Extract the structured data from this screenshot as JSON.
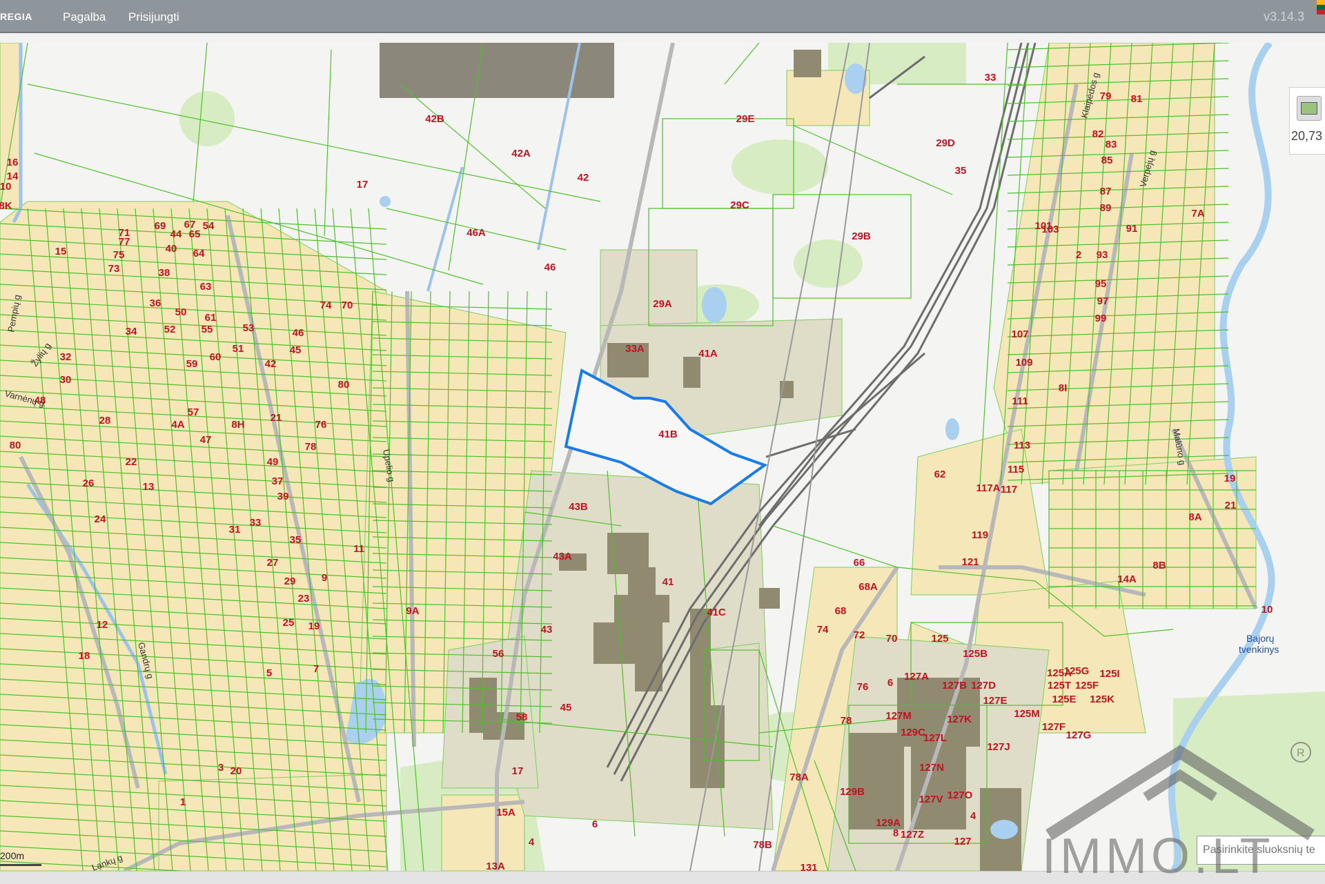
{
  "header": {
    "brand": "REGIA",
    "menu": [
      "Pagalba",
      "Prisijungti"
    ],
    "version": "v3.14.3"
  },
  "map": {
    "parcel_labels": [
      {
        "t": "42B"
      },
      {
        "t": "42A"
      },
      {
        "t": "42"
      },
      {
        "t": "46A"
      },
      {
        "t": "46"
      },
      {
        "t": "17"
      },
      {
        "t": "29E"
      },
      {
        "t": "29D"
      },
      {
        "t": "35"
      },
      {
        "t": "33"
      },
      {
        "t": "29C"
      },
      {
        "t": "29B"
      },
      {
        "t": "29A"
      },
      {
        "t": "33A"
      },
      {
        "t": "41A"
      },
      {
        "t": "41B"
      },
      {
        "t": "43B"
      },
      {
        "t": "43A"
      },
      {
        "t": "41"
      },
      {
        "t": "41C"
      },
      {
        "t": "43"
      },
      {
        "t": "45"
      },
      {
        "t": "56"
      },
      {
        "t": "58"
      },
      {
        "t": "17"
      },
      {
        "t": "15A"
      },
      {
        "t": "6"
      },
      {
        "t": "4"
      },
      {
        "t": "13A"
      },
      {
        "t": "78B"
      },
      {
        "t": "78A"
      },
      {
        "t": "131"
      },
      {
        "t": "66"
      },
      {
        "t": "68A"
      },
      {
        "t": "68"
      },
      {
        "t": "74"
      },
      {
        "t": "72"
      },
      {
        "t": "70"
      },
      {
        "t": "76"
      },
      {
        "t": "78"
      },
      {
        "t": "125"
      },
      {
        "t": "125B"
      },
      {
        "t": "125A"
      },
      {
        "t": "127A"
      },
      {
        "t": "127B"
      },
      {
        "t": "127D"
      },
      {
        "t": "127E"
      },
      {
        "t": "125M"
      },
      {
        "t": "127M"
      },
      {
        "t": "127K"
      },
      {
        "t": "127F"
      },
      {
        "t": "129C"
      },
      {
        "t": "127L"
      },
      {
        "t": "127G"
      },
      {
        "t": "127J"
      },
      {
        "t": "127N"
      },
      {
        "t": "129B"
      },
      {
        "t": "127V"
      },
      {
        "t": "127O"
      },
      {
        "t": "129A"
      },
      {
        "t": "127Z"
      },
      {
        "t": "127"
      },
      {
        "t": "125G"
      },
      {
        "t": "125T"
      },
      {
        "t": "125F"
      },
      {
        "t": "125I"
      },
      {
        "t": "125E"
      },
      {
        "t": "125K"
      },
      {
        "t": "62"
      },
      {
        "t": "117A"
      },
      {
        "t": "117"
      },
      {
        "t": "115"
      },
      {
        "t": "113"
      },
      {
        "t": "111"
      },
      {
        "t": "109"
      },
      {
        "t": "119"
      },
      {
        "t": "121"
      },
      {
        "t": "107"
      },
      {
        "t": "14A"
      },
      {
        "t": "8B"
      },
      {
        "t": "8A"
      },
      {
        "t": "19"
      },
      {
        "t": "21"
      },
      {
        "t": "10"
      },
      {
        "t": "7A"
      },
      {
        "t": "80"
      },
      {
        "t": "48"
      },
      {
        "t": "9A"
      },
      {
        "t": "1"
      },
      {
        "t": "12"
      },
      {
        "t": "3"
      },
      {
        "t": "5"
      },
      {
        "t": "7"
      },
      {
        "t": "9"
      },
      {
        "t": "11"
      },
      {
        "t": "13"
      },
      {
        "t": "15"
      },
      {
        "t": "18"
      },
      {
        "t": "20"
      },
      {
        "t": "22"
      },
      {
        "t": "24"
      },
      {
        "t": "26"
      },
      {
        "t": "28"
      },
      {
        "t": "30"
      },
      {
        "t": "32"
      },
      {
        "t": "34"
      },
      {
        "t": "36"
      },
      {
        "t": "38"
      },
      {
        "t": "40"
      },
      {
        "t": "44"
      },
      {
        "t": "50"
      },
      {
        "t": "52"
      },
      {
        "t": "54"
      },
      {
        "t": "55"
      },
      {
        "t": "57"
      },
      {
        "t": "59"
      },
      {
        "t": "60"
      },
      {
        "t": "61"
      },
      {
        "t": "63"
      },
      {
        "t": "64"
      },
      {
        "t": "65"
      },
      {
        "t": "67"
      },
      {
        "t": "69"
      },
      {
        "t": "71"
      },
      {
        "t": "73"
      },
      {
        "t": "75"
      },
      {
        "t": "77"
      },
      {
        "t": "79"
      },
      {
        "t": "81"
      },
      {
        "t": "82"
      },
      {
        "t": "83"
      },
      {
        "t": "85"
      },
      {
        "t": "87"
      },
      {
        "t": "89"
      },
      {
        "t": "91"
      },
      {
        "t": "93"
      },
      {
        "t": "95"
      },
      {
        "t": "97"
      },
      {
        "t": "99"
      },
      {
        "t": "101"
      },
      {
        "t": "103"
      },
      {
        "t": "2"
      },
      {
        "t": "4"
      },
      {
        "t": "6"
      },
      {
        "t": "8"
      },
      {
        "t": "16"
      },
      {
        "t": "14"
      },
      {
        "t": "10"
      },
      {
        "t": "8K"
      },
      {
        "t": "8I"
      },
      {
        "t": "8H"
      },
      {
        "t": "4A"
      },
      {
        "t": "47"
      },
      {
        "t": "49"
      },
      {
        "t": "37"
      },
      {
        "t": "39"
      },
      {
        "t": "31"
      },
      {
        "t": "33"
      },
      {
        "t": "35"
      },
      {
        "t": "27"
      },
      {
        "t": "29"
      },
      {
        "t": "23"
      },
      {
        "t": "25"
      },
      {
        "t": "19"
      },
      {
        "t": "21"
      },
      {
        "t": "42"
      },
      {
        "t": "45"
      },
      {
        "t": "46"
      },
      {
        "t": "53"
      },
      {
        "t": "51"
      },
      {
        "t": "74"
      },
      {
        "t": "70"
      },
      {
        "t": "76"
      },
      {
        "t": "78"
      },
      {
        "t": "80"
      },
      {
        "t": "62"
      },
      {
        "t": "66"
      },
      {
        "t": "68"
      },
      {
        "t": "58"
      },
      {
        "t": "56"
      },
      {
        "t": "41"
      }
    ],
    "streets": [
      "Pempių g",
      "Žylių g",
      "Varnėnų g",
      "Gandrų g",
      "Lankų g",
      "Upelio g",
      "Klaipėdos g",
      "Verpėjų g",
      "Malūno g"
    ],
    "water_label": "Bajorų tvenkinys",
    "highlighted_parcel": "41B"
  },
  "right_widget": {
    "value": "20,73"
  },
  "scale": {
    "label": "200m"
  },
  "layer_select": {
    "placeholder": "Pasirinkite sluoksnių te"
  },
  "watermark": {
    "text": "IMMO.LT"
  },
  "colors": {
    "topbar": "#8e969b",
    "parcel_outline": "#4ec02a",
    "residential": "#f6e7b8",
    "industrial": "#dfdcc8",
    "highlight": "#1a7ce6",
    "label": "#c1121f",
    "water": "#a9d0ef",
    "forest": "#d8ecc4"
  }
}
